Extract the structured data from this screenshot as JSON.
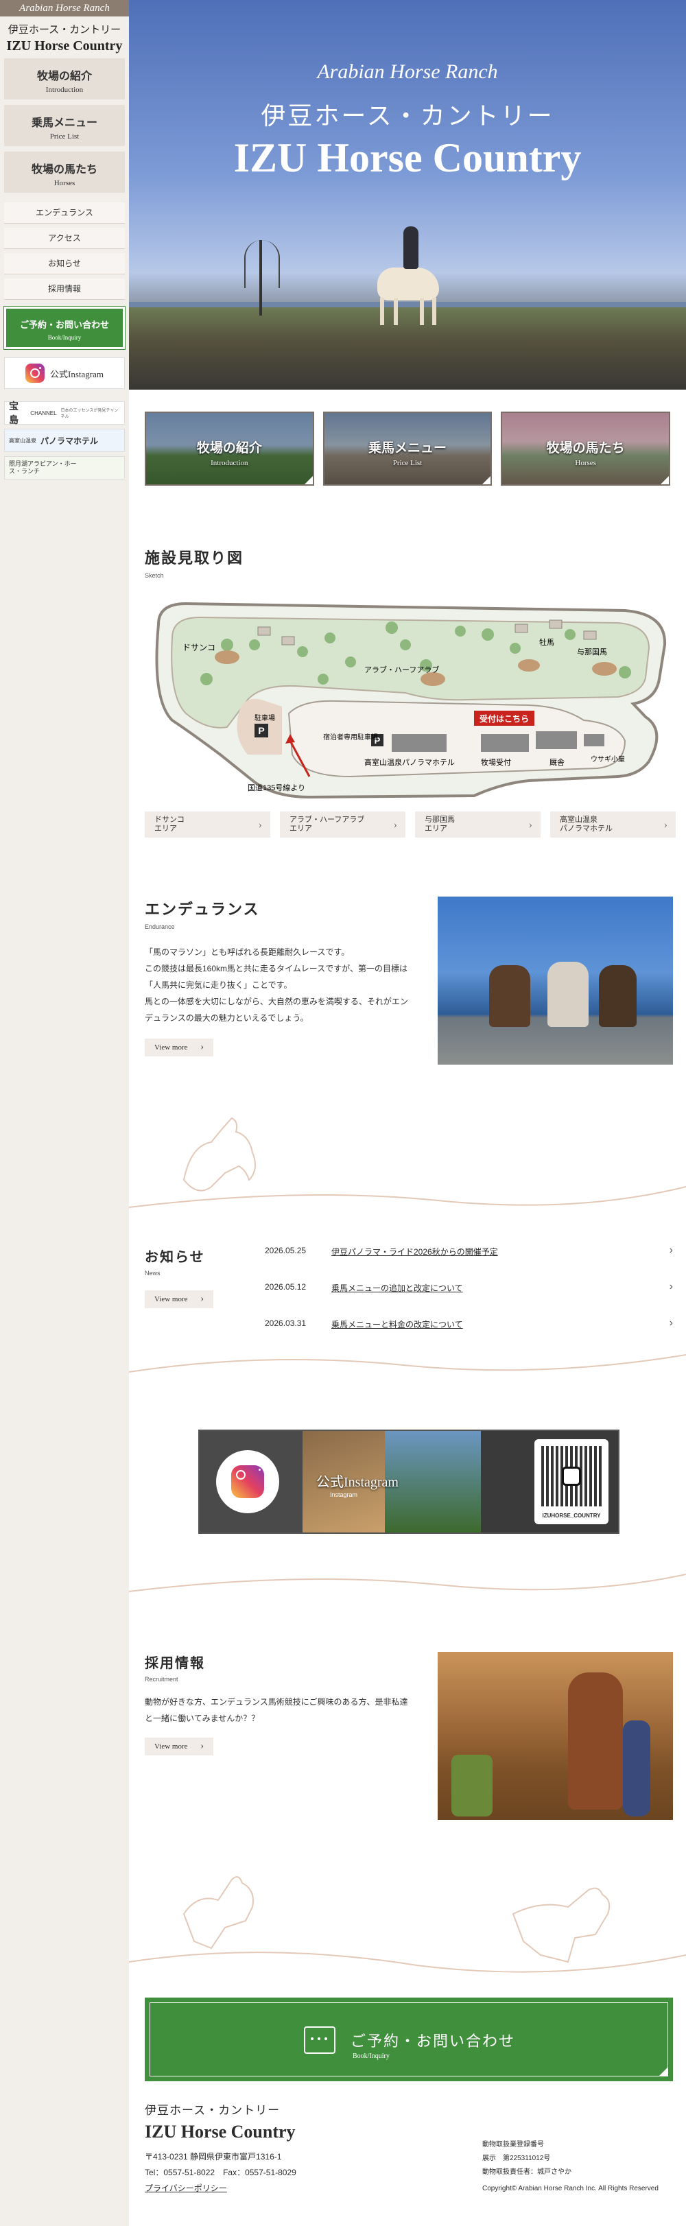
{
  "sidebar": {
    "brand": "Arabian Horse Ranch",
    "logo_jp": "伊豆ホース・カントリー",
    "logo_en": "IZU Horse Country",
    "main_nav": [
      {
        "label": "牧場の紹介",
        "sub": "Introduction"
      },
      {
        "label": "乗馬メニュー",
        "sub": "Price List"
      },
      {
        "label": "牧場の馬たち",
        "sub": "Horses"
      }
    ],
    "sub_nav": [
      "エンデュランス",
      "アクセス",
      "お知らせ",
      "採用情報"
    ],
    "cta": {
      "label": "ご予約・お問い合わせ",
      "sub": "Book/Inquiry"
    },
    "instagram": "公式Instagram",
    "banners": [
      {
        "title": "宝島",
        "sub": "CHANNEL",
        "note": "日本のエッセンスが発見チャンネル"
      },
      {
        "title": "パノラマホテル",
        "sub": "高室山温泉",
        "note": ""
      },
      {
        "title": "照月湖アラビアン・ホース・ランチ",
        "sub": "",
        "note": ""
      }
    ]
  },
  "hero": {
    "brand": "Arabian Horse Ranch",
    "title_jp": "伊豆ホース・カントリー",
    "title_en": "IZU Horse Country"
  },
  "cards": [
    {
      "title": "牧場の紹介",
      "sub": "Introduction"
    },
    {
      "title": "乗馬メニュー",
      "sub": "Price List"
    },
    {
      "title": "牧場の馬たち",
      "sub": "Horses"
    }
  ],
  "facility": {
    "title": "施設見取り図",
    "sub": "Sketch",
    "map_labels": {
      "dosanko": "ドサンコ",
      "arab": "アラブ・ハーフアラブ",
      "pony": "牡馬",
      "yonaguni": "与那国馬",
      "parking": "駐車場",
      "guest_parking": "宿泊者専用駐車場",
      "reception": "受付はこちら",
      "hotel": "高室山温泉パノラマホテル",
      "stable_reception": "牧場受付",
      "lodge": "厩舎",
      "rabbit": "ウサギ小屋",
      "route": "国道135号線より",
      "p": "P"
    },
    "buttons": [
      {
        "l1": "ドサンコ",
        "l2": "エリア"
      },
      {
        "l1": "アラブ・ハーフアラブ",
        "l2": "エリア"
      },
      {
        "l1": "与那国馬",
        "l2": "エリア"
      },
      {
        "l1": "高室山温泉",
        "l2": "パノラマホテル"
      }
    ]
  },
  "endurance": {
    "title": "エンデュランス",
    "sub": "Endurance",
    "lines": [
      "「馬のマラソン」とも呼ばれる長距離耐久レースです。",
      "この競技は最長160km馬と共に走るタイムレースですが、第一の目標は",
      "「人馬共に完気に走り抜く」ことです。",
      "馬との一体感を大切にしながら、大自然の恵みを満喫する、それがエン",
      "デュランスの最大の魅力といえるでしょう。"
    ],
    "more": "View more"
  },
  "news": {
    "title": "お知らせ",
    "sub": "News",
    "more": "View more",
    "items": [
      {
        "date": "2026.05.25",
        "title": "伊豆パノラマ・ライド2026秋からの開催予定"
      },
      {
        "date": "2026.05.12",
        "title": "乗馬メニューの追加と改定について"
      },
      {
        "date": "2026.03.31",
        "title": "乗馬メニューと料金の改定について"
      }
    ]
  },
  "instagram_banner": {
    "title": "公式Instagram",
    "sub": "Instagram",
    "handle": "IZUHORSE_COUNTRY"
  },
  "recruit": {
    "title": "採用情報",
    "sub": "Recruitment",
    "lines": [
      "動物が好きな方、エンデュランス馬術競技にご興味のある方、是非私達",
      "と一緒に働いてみませんか？？"
    ],
    "more": "View more"
  },
  "contact": {
    "label": "ご予約・お問い合わせ",
    "sub": "Book/Inquiry"
  },
  "footer": {
    "name_jp": "伊豆ホース・カントリー",
    "name_en": "IZU Horse Country",
    "address": "〒413-0231 静岡県伊東市富戸1316-1",
    "tel": "Tel：0557-51-8022　Fax：0557-51-8029",
    "privacy": "プライバシーポリシー",
    "reg1": "動物取扱業登録番号",
    "reg2": "展示　第225311012号",
    "reg3": "動物取扱責任者：城戸さやか",
    "copyright": "Copyright© Arabian Horse Ranch Inc. All Rights Reserved"
  },
  "colors": {
    "accent": "#3f8f3d",
    "beige": "#f1ece7",
    "brand_brown": "#8b7d70",
    "red": "#c8241d"
  }
}
